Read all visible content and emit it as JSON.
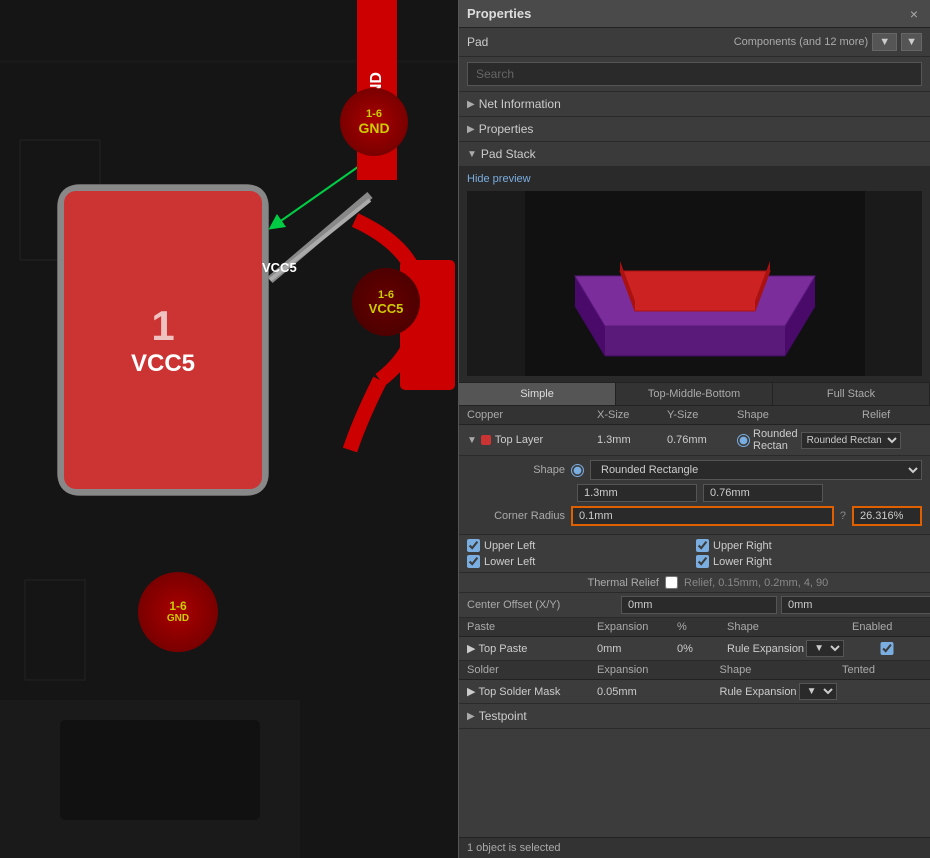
{
  "panel": {
    "title": "Properties",
    "close_btn": "×",
    "pin_btn": "📌",
    "pad_label": "Pad",
    "components_text": "Components (and 12 more)",
    "filter_icon": "▼",
    "search_placeholder": "Search"
  },
  "sections": {
    "net_information": "Net Information",
    "properties": "Properties",
    "pad_stack": "Pad Stack",
    "testpoint": "Testpoint"
  },
  "preview": {
    "hide_link": "Hide preview"
  },
  "stack_tabs": [
    "Simple",
    "Top-Middle-Bottom",
    "Full Stack"
  ],
  "copper_headers": [
    "Copper",
    "X-Size",
    "Y-Size",
    "Shape",
    "Relief"
  ],
  "top_layer": {
    "name": "Top Layer",
    "x_size": "1.3mm",
    "y_size": "0.76mm",
    "shape": "Rounded Rectan",
    "relief": ""
  },
  "shape_section": {
    "label": "Shape",
    "value": "Rounded Rectangle",
    "radio_label": "Rounded Rectangle"
  },
  "xy": {
    "x": "1.3mm",
    "y": "0.76mm"
  },
  "corner_radius": {
    "label": "Corner Radius",
    "value": "0.1mm",
    "percent": "26.316%"
  },
  "checkboxes": {
    "upper_left": "Upper Left",
    "upper_right": "Upper Right",
    "lower_left": "Lower Left",
    "lower_right": "Lower Right"
  },
  "thermal": {
    "label": "Thermal Relief",
    "value": "Relief, 0.15mm, 0.2mm, 4, 90"
  },
  "center_offset": {
    "label": "Center Offset (X/Y)",
    "x": "0mm",
    "y": "0mm"
  },
  "paste_headers": [
    "Paste",
    "Expansion",
    "%",
    "Shape",
    "Enabled"
  ],
  "top_paste": {
    "name": "Top Paste",
    "expansion": "0mm",
    "percent": "0%",
    "shape": "Rule Expansion"
  },
  "solder_headers": [
    "Solder",
    "Expansion",
    "Shape",
    "Tented"
  ],
  "top_solder_mask": {
    "name": "Top Solder Mask",
    "expansion": "0.05mm",
    "shape": "Rule Expansion"
  },
  "status": "1 object is selected",
  "pcb": {
    "gnd_label": "GND",
    "vcc5_label": "VCC5",
    "pin_prefix": "1-6"
  }
}
